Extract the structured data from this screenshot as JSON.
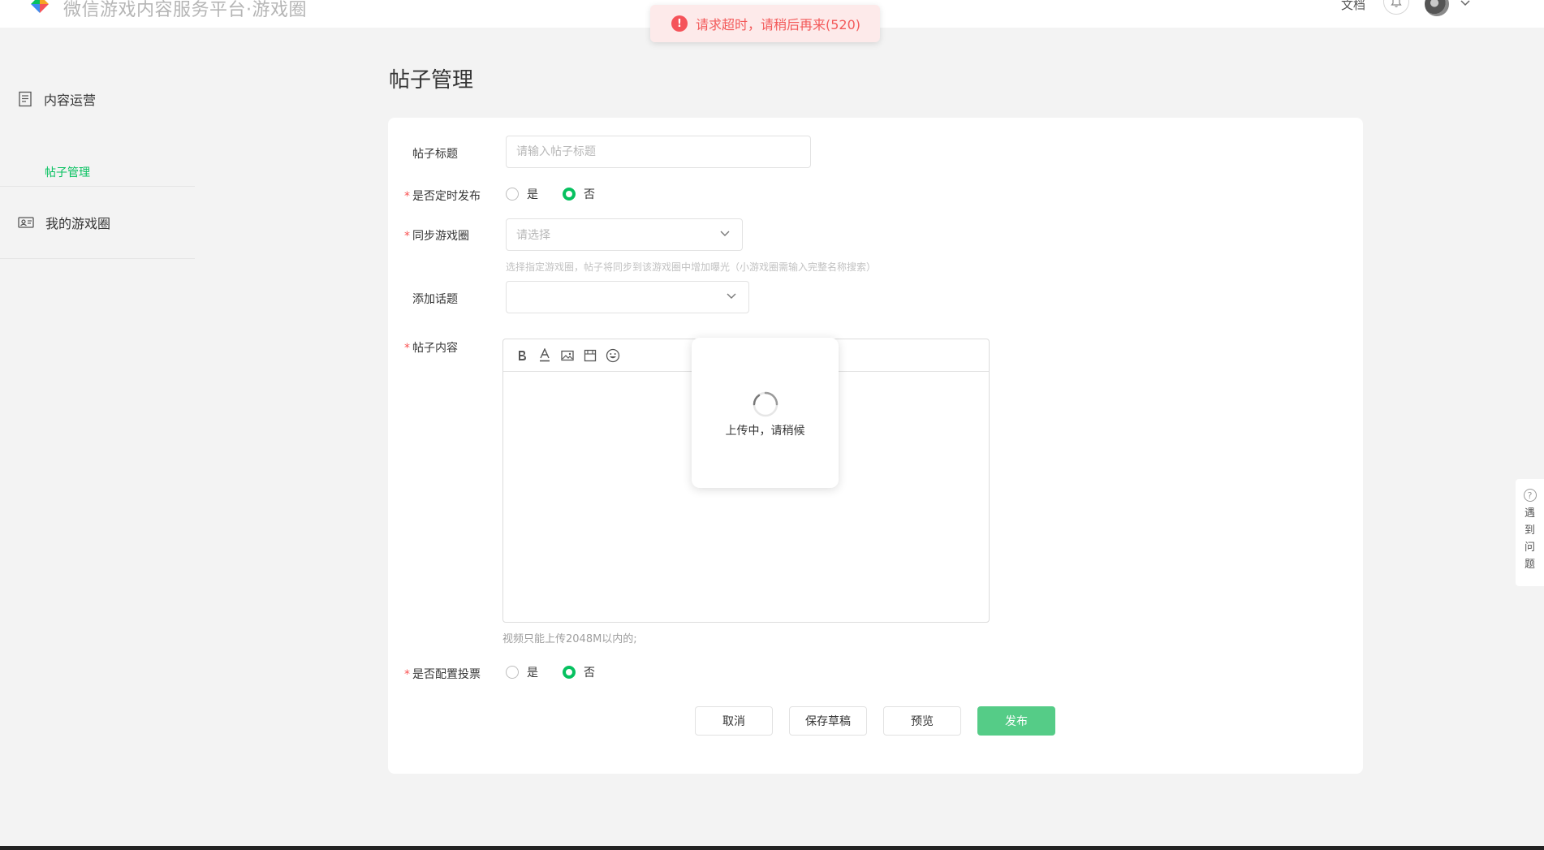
{
  "header": {
    "brand": "微信游戏内容服务平台·游戏圈",
    "doc_link": "文档"
  },
  "toast": {
    "message": "请求超时，请稍后再来(520)"
  },
  "sidebar": {
    "groups": [
      {
        "label": "内容运营",
        "icon": "document-icon",
        "items": [
          {
            "label": "帖子管理",
            "active": true
          }
        ]
      },
      {
        "label": "我的游戏圈",
        "icon": "id-card-icon",
        "items": []
      }
    ]
  },
  "page": {
    "title": "帖子管理"
  },
  "form": {
    "post_title": {
      "label": "帖子标题",
      "placeholder": "请输入帖子标题",
      "value": ""
    },
    "scheduled": {
      "label": "是否定时发布",
      "required": true,
      "options": [
        "是",
        "否"
      ],
      "selected": "否"
    },
    "sync_circle": {
      "label": "同步游戏圈",
      "required": true,
      "placeholder": "请选择",
      "hint": "选择指定游戏圈，帖子将同步到该游戏圈中增加曝光（小游戏圈需输入完整名称搜索）"
    },
    "topic": {
      "label": "添加话题",
      "value": ""
    },
    "content": {
      "label": "帖子内容",
      "required": true,
      "toolbar": [
        "bold-icon",
        "font-color-icon",
        "image-icon",
        "video-icon",
        "emoji-icon"
      ],
      "hint": "视频只能上传2048M以内的;"
    },
    "vote": {
      "label": "是否配置投票",
      "required": true,
      "options": [
        "是",
        "否"
      ],
      "selected": "否"
    }
  },
  "loading": {
    "text": "上传中，请稍候"
  },
  "actions": {
    "cancel": "取消",
    "save_draft": "保存草稿",
    "preview": "预览",
    "publish": "发布"
  },
  "help": {
    "text": "遇到问题"
  },
  "colors": {
    "accent": "#07c160",
    "primary_button": "#55cc87",
    "error": "#f5535a",
    "required": "#fa5151"
  }
}
